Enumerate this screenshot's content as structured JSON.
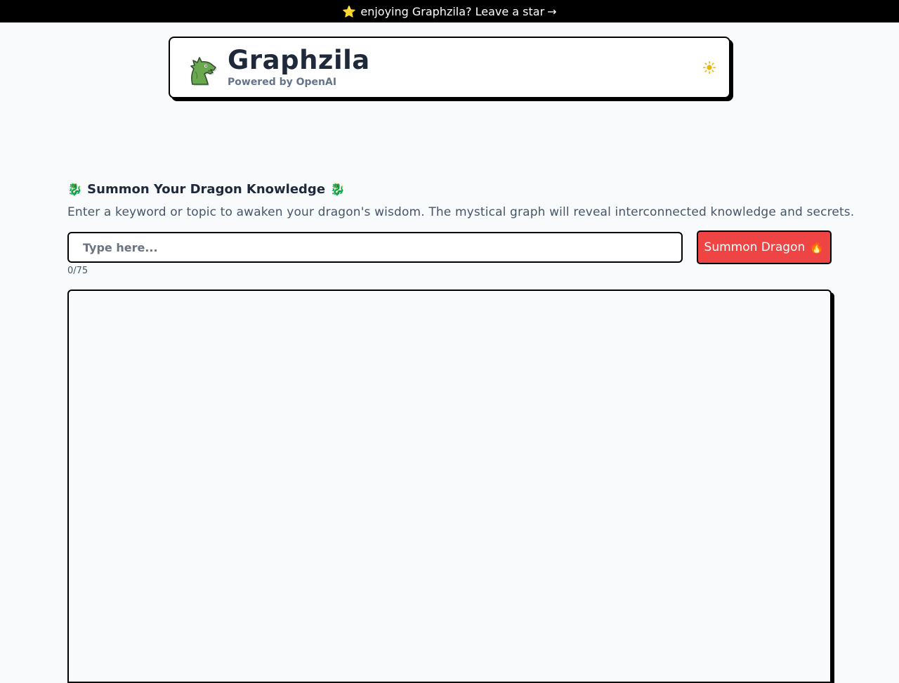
{
  "banner": {
    "star_icon": "⭐",
    "text": "enjoying Graphzila? Leave a star",
    "arrow_icon": "→"
  },
  "header": {
    "logo_icon": "dragon-head-icon",
    "title": "Graphzila",
    "subtitle": "Powered by OpenAI",
    "theme_icon": "sun-icon"
  },
  "prompt": {
    "heading": "Summon Your Dragon Knowledge",
    "heading_emoji": "🐉",
    "description": "Enter a keyword or topic to awaken your dragon's wisdom. The mystical graph will reveal interconnected knowledge and secrets.",
    "input_placeholder": "Type here...",
    "input_value": "",
    "char_count": "0/75",
    "button_label": "Summon Dragon",
    "button_emoji": "🔥"
  },
  "colors": {
    "page_background": "#f8fafc",
    "banner_background": "#000000",
    "button_background": "#ef4444",
    "title_color": "#1e293b",
    "sun_color": "#eab308",
    "dragon_green": "#6aa84f"
  }
}
